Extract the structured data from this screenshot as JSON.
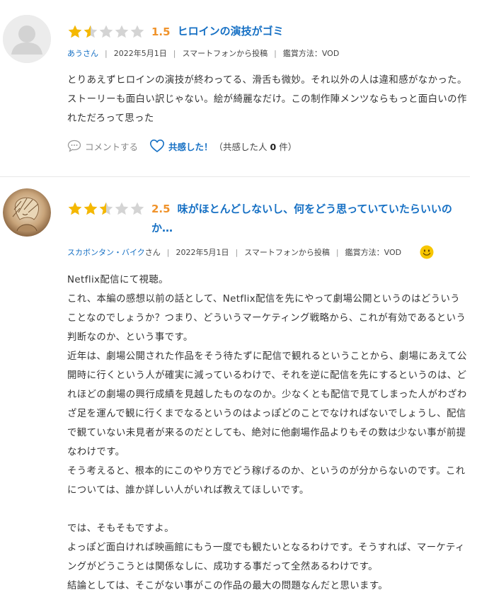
{
  "reviews": [
    {
      "score": "1.5",
      "stars": [
        1,
        0.5,
        0,
        0,
        0
      ],
      "title": "ヒロインの演技がゴミ",
      "user": "あうさん",
      "user_name": "あう",
      "user_suffix": "さん",
      "date": "2022年5月1日",
      "source": "スマートフォンから投稿",
      "method": "鑑賞方法：VOD",
      "body": [
        "とりあえずヒロインの演技が終わってる、滑舌も微妙。それ以外の人は違和感がなかった。ストーリーも面白い訳じゃない。絵が綺麗なだけ。この制作陣メンツならもっと面白いの作れただろって思った"
      ],
      "comment_label": "コメントする",
      "like_label": "共感した！",
      "like_count_prefix": "（共感した人",
      "like_count": "0",
      "like_count_suffix": "件）"
    },
    {
      "score": "2.5",
      "stars": [
        1,
        1,
        0.5,
        0,
        0
      ],
      "title": "味がほとんどしないし、何をどう思っていていたらいいのか…",
      "user_name": "スカボンタン・バイク",
      "user_suffix": "さん",
      "date": "2022年5月1日",
      "source": "スマートフォンから投稿",
      "method": "鑑賞方法：VOD",
      "mood_icon": "smile-icon",
      "body": [
        "Netflix配信にて視聴。",
        "これ、本編の感想以前の話として、Netflix配信を先にやって劇場公開というのはどういうことなのでしょうか？つまり、どういうマーケティング戦略から、これが有効であるという判断なのか、という事です。",
        "近年は、劇場公開された作品をそう待たずに配信で観れるということから、劇場にあえて公開時に行くという人が確実に減っているわけで、それを逆に配信を先にするというのは、どれほどの劇場の興行成績を見越したものなのか。少なくとも配信で見てしまった人がわざわざ足を運んで観に行くまでなるというのはよっぽどのことでなければないでしょうし、配信で観ていない未見者が来るのだとしても、絶対に他劇場作品よりもその数は少ない事が前提なわけです。",
        "そう考えると、根本的にこのやり方でどう稼げるのか、というのが分からないのです。これについては、誰か詳しい人がいれば教えてほしいです。",
        "",
        "では、そもそもですよ。",
        "よっぽど面白ければ映画館にもう一度でも観たいとなるわけです。そうすれば、マーケティングがどうこうとは関係なしに、成功する事だって全然あるわけです。",
        "結論としては、そこがない事がこの作品の最大の問題なんだと思います。"
      ]
    }
  ],
  "colors": {
    "star": "#f5b800",
    "star_empty": "#d4d4d4",
    "score": "#f0932b",
    "link": "#1670c4"
  }
}
